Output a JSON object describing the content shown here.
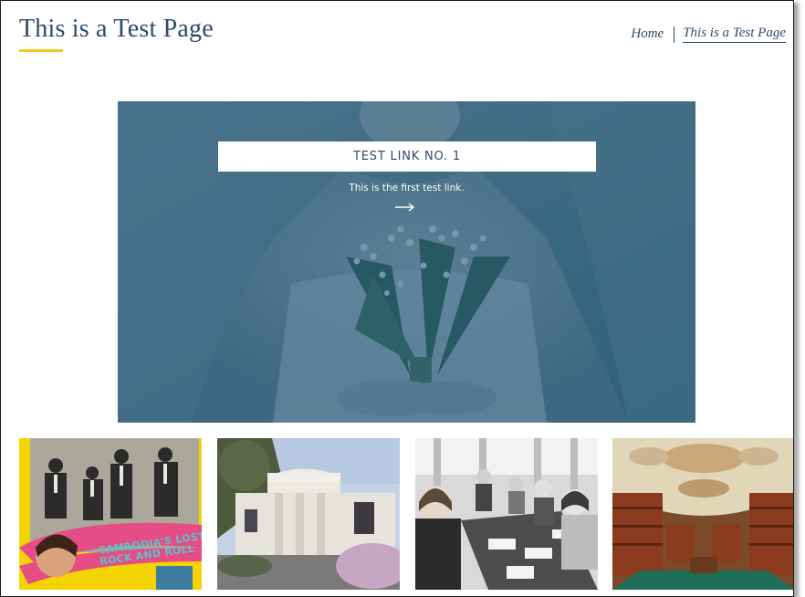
{
  "header": {
    "site_title": "This is a Test Page",
    "accent_color": "#f2c51c",
    "title_color": "#2c4a6b"
  },
  "breadcrumb": {
    "home_label": "Home",
    "current_label": "This is a Test Page"
  },
  "hero": {
    "link_label": "TEST LINK NO. 1",
    "description": "This is the first test link.",
    "arrow_icon": "arrow-right-icon",
    "overlay_color": "#225874"
  },
  "thumbnails": [
    {
      "subject": "band-poster-photo",
      "caption_line1": "CAMBODIA'S LOST",
      "caption_line2": "ROCK AND ROLL"
    },
    {
      "subject": "white-house-photo"
    },
    {
      "subject": "students-at-table-photo"
    },
    {
      "subject": "library-hall-photo"
    }
  ]
}
